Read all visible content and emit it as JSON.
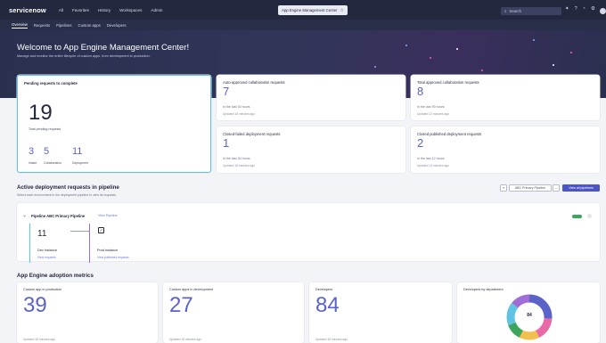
{
  "topnav": {
    "logo": "servicenow",
    "links": [
      "All",
      "Favorites",
      "History",
      "Workspaces",
      "Admin"
    ],
    "app_title": "App Engine Management Center",
    "app_title_icon": "star-icon",
    "search_placeholder": "Search"
  },
  "subnav": {
    "tabs": [
      "Overview",
      "Requests",
      "Pipelines",
      "Custom apps",
      "Developers"
    ],
    "active_tab": "Overview"
  },
  "hero": {
    "title": "Welcome to App Engine Management Center!",
    "subtitle": "Manage and monitor the entire lifecycle of custom apps, from development to production."
  },
  "pending": {
    "title": "Pending requests to complete",
    "total": "19",
    "total_label": "Total pending requests",
    "breakdown": [
      {
        "value": "3",
        "label": "Intake"
      },
      {
        "value": "5",
        "label": "Collaboration"
      },
      {
        "value": "11",
        "label": "Deployment"
      }
    ]
  },
  "summary_cards": [
    {
      "title": "Auto-approved collaboration requests",
      "value": "7",
      "period": "In the last 30 hours",
      "updated": "Updated 18 minutes ago"
    },
    {
      "title": "Total approved collaboration requests",
      "value": "8",
      "period": "In the last 90 hours",
      "updated": "Updated 12 minutes ago"
    },
    {
      "title": "Closed-failed deployment requests",
      "value": "1",
      "period": "In the last 30 hours",
      "updated": "Updated 18 minutes ago"
    },
    {
      "title": "Closed published deployment requests",
      "value": "2",
      "period": "In the last 12 hours",
      "updated": "Updated 12 minutes ago"
    }
  ],
  "deployment": {
    "title": "Active deployment requests in pipeline",
    "subtitle": "Select each environment in the deployment pipeline to view its requests.",
    "filter_label": "ABC Primary Pipeline",
    "view_all_label": "View all pipelines",
    "pipeline_name": "Pipeline ABC Primary Pipeline",
    "pipeline_link": "View Pipeline",
    "stages": [
      {
        "value": "11",
        "label": "Dev instance",
        "link": "View requests"
      },
      {
        "value": "",
        "label": "Prod instance",
        "link": "View published requests"
      }
    ]
  },
  "metrics": {
    "title": "App Engine adoption metrics",
    "cards": [
      {
        "title": "Custom app in production",
        "value": "39",
        "updated": "Updated 18 minutes ago"
      },
      {
        "title": "Custom apps in development",
        "value": "27",
        "updated": "Updated 18 minutes ago"
      },
      {
        "title": "Developers",
        "value": "84",
        "updated": "Updated 18 minutes ago"
      }
    ],
    "donut_title": "Developers by department",
    "donut_center": "84",
    "donut_segments": [
      {
        "value": 22,
        "color": "#5b63c9"
      },
      {
        "value": 14,
        "color": "#e86aa7"
      },
      {
        "value": 12,
        "color": "#f2c04e"
      },
      {
        "value": 10,
        "color": "#3ca55c"
      },
      {
        "value": 14,
        "color": "#5fc3e4"
      },
      {
        "value": 12,
        "color": "#a06cd5"
      }
    ]
  }
}
